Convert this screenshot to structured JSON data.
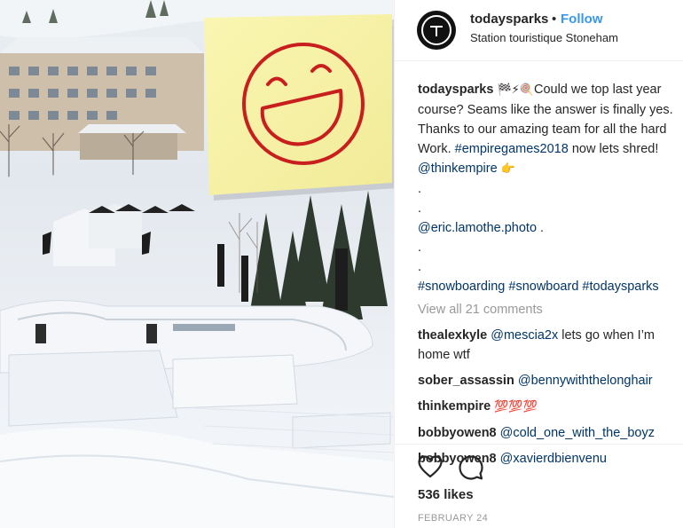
{
  "post": {
    "username": "todaysparks",
    "separator": "•",
    "follow_label": "Follow",
    "location": "Station touristique Stoneham"
  },
  "caption": {
    "username": "todaysparks",
    "emojis": "🏁⚡🍭",
    "text_1": "Could we top last year course? Seams like the answer is finally yes. Thanks to our amazing team for all the hard Work. ",
    "hashtag_1": "#empiregames2018",
    "text_2": " now lets shred!",
    "mention_1": "@thinkempire",
    "mention_1_emoji": "👉",
    "dot": ".",
    "mention_2": "@eric.lamothe.photo",
    "mention_2_suffix": " .",
    "hashtags": "#snowboarding #snowboard #todaysparks"
  },
  "view_all_comments": "View all 21 comments",
  "comments": [
    {
      "username": "thealexkyle",
      "mention": "@mescia2x",
      "text": " lets go when I’m home wtf"
    },
    {
      "username": "sober_assassin",
      "mention": "@bennywiththelonghair",
      "text": ""
    },
    {
      "username": "thinkempire",
      "mention": "",
      "text": "💯💯💯"
    },
    {
      "username": "bobbyowen8",
      "mention": "@cold_one_with_the_boyz",
      "text": ""
    },
    {
      "username": "bobbyowen8",
      "mention": "@xavierdbienvenu",
      "text": ""
    }
  ],
  "actions": {
    "like_icon": "heart-icon",
    "comment_icon": "comment-bubble-icon"
  },
  "likes": "536 likes",
  "date": "FEBRUARY 24",
  "colors": {
    "follow": "#3897f0",
    "link": "#003569",
    "muted": "#999999",
    "sticky_note": "#f7f3a6",
    "smiley": "#c81e1e"
  }
}
